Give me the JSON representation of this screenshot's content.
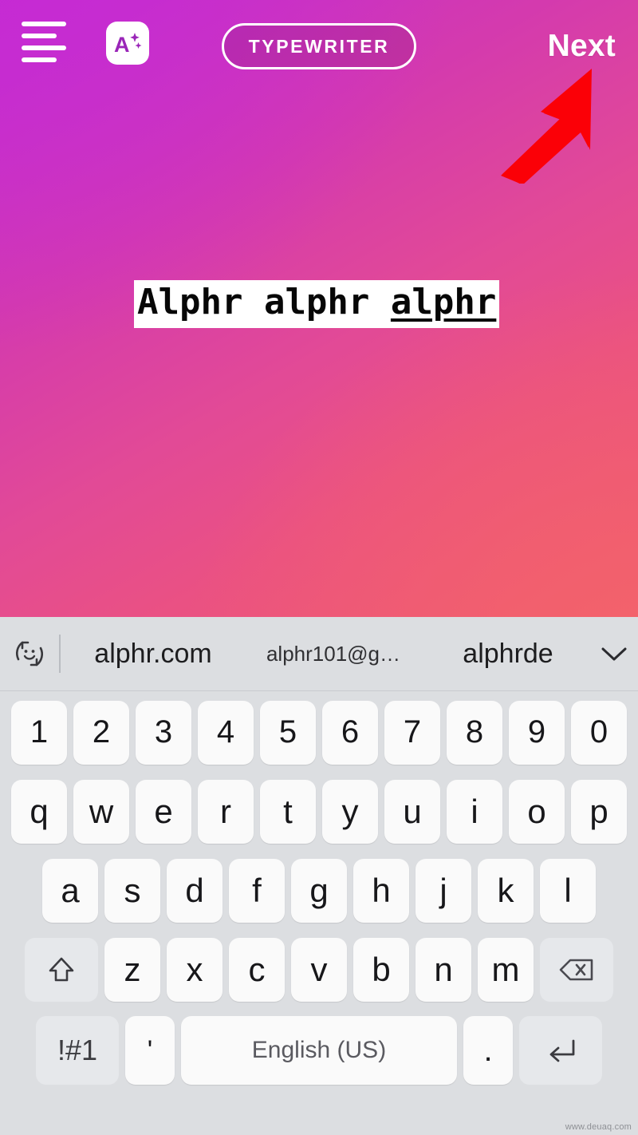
{
  "topbar": {
    "menu_icon": "hamburger-align-icon",
    "text_format_icon": "a-plus-sparkle-icon",
    "font_style_label": "TYPEWRITER",
    "next_label": "Next",
    "annotation_icon": "red-arrow-pointing-to-next"
  },
  "canvas": {
    "background_gradient_start": "#c22ed0",
    "background_gradient_mid": "#e24a96",
    "background_gradient_end": "#ee5a72",
    "text_words": [
      {
        "text": "Alphr ",
        "underlined": false
      },
      {
        "text": "alphr ",
        "underlined": false
      },
      {
        "text": "alphr",
        "underlined": true
      }
    ],
    "text_background": "#ffffff",
    "text_color": "#070707"
  },
  "keyboard": {
    "background": "#dcdee1",
    "key_color": "#fafafa",
    "mod_key_color": "#e6e8eb",
    "suggestion_bar": {
      "emoji_icon": "smiley-rotate-icon",
      "suggestions": [
        "alphr.com",
        "alphr101@g…",
        "alphrde"
      ],
      "expand_icon": "chevron-down-icon"
    },
    "rows": [
      {
        "name": "number-row",
        "keys": [
          "1",
          "2",
          "3",
          "4",
          "5",
          "6",
          "7",
          "8",
          "9",
          "0"
        ]
      },
      {
        "name": "qwerty-row",
        "keys": [
          "q",
          "w",
          "e",
          "r",
          "t",
          "y",
          "u",
          "i",
          "o",
          "p"
        ]
      },
      {
        "name": "home-row",
        "keys": [
          "a",
          "s",
          "d",
          "f",
          "g",
          "h",
          "j",
          "k",
          "l"
        ]
      },
      {
        "name": "bottom-letter-row",
        "keys": [
          "z",
          "x",
          "c",
          "v",
          "b",
          "n",
          "m"
        ]
      }
    ],
    "shift_label": "shift-arrow-icon",
    "backspace_label": "backspace-icon",
    "symbols_label": "!#1",
    "apostrophe_label": "'",
    "space_label": "English (US)",
    "period_label": ".",
    "enter_label": "enter-icon"
  },
  "watermark": "www.deuaq.com"
}
